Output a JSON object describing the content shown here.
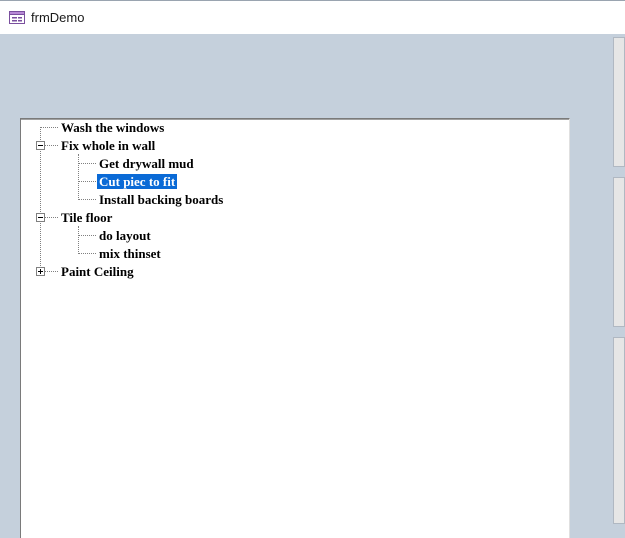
{
  "window": {
    "title": "frmDemo",
    "icon": "form-icon"
  },
  "tree": {
    "nodes": [
      {
        "label": "Wash the windows",
        "level": 0,
        "state": "leaf"
      },
      {
        "label": "Fix whole in wall",
        "level": 0,
        "state": "expanded"
      },
      {
        "label": "Get drywall mud",
        "level": 1,
        "state": "leaf"
      },
      {
        "label": "Cut piec to fit",
        "level": 1,
        "state": "leaf",
        "selected": true
      },
      {
        "label": "Install backing boards",
        "level": 1,
        "state": "leaf"
      },
      {
        "label": "Tile floor",
        "level": 0,
        "state": "expanded"
      },
      {
        "label": "do layout",
        "level": 1,
        "state": "leaf"
      },
      {
        "label": "mix thinset",
        "level": 1,
        "state": "leaf"
      },
      {
        "label": "Paint Ceiling",
        "level": 0,
        "state": "collapsed"
      }
    ],
    "selection_color": "#0a6ad6"
  }
}
